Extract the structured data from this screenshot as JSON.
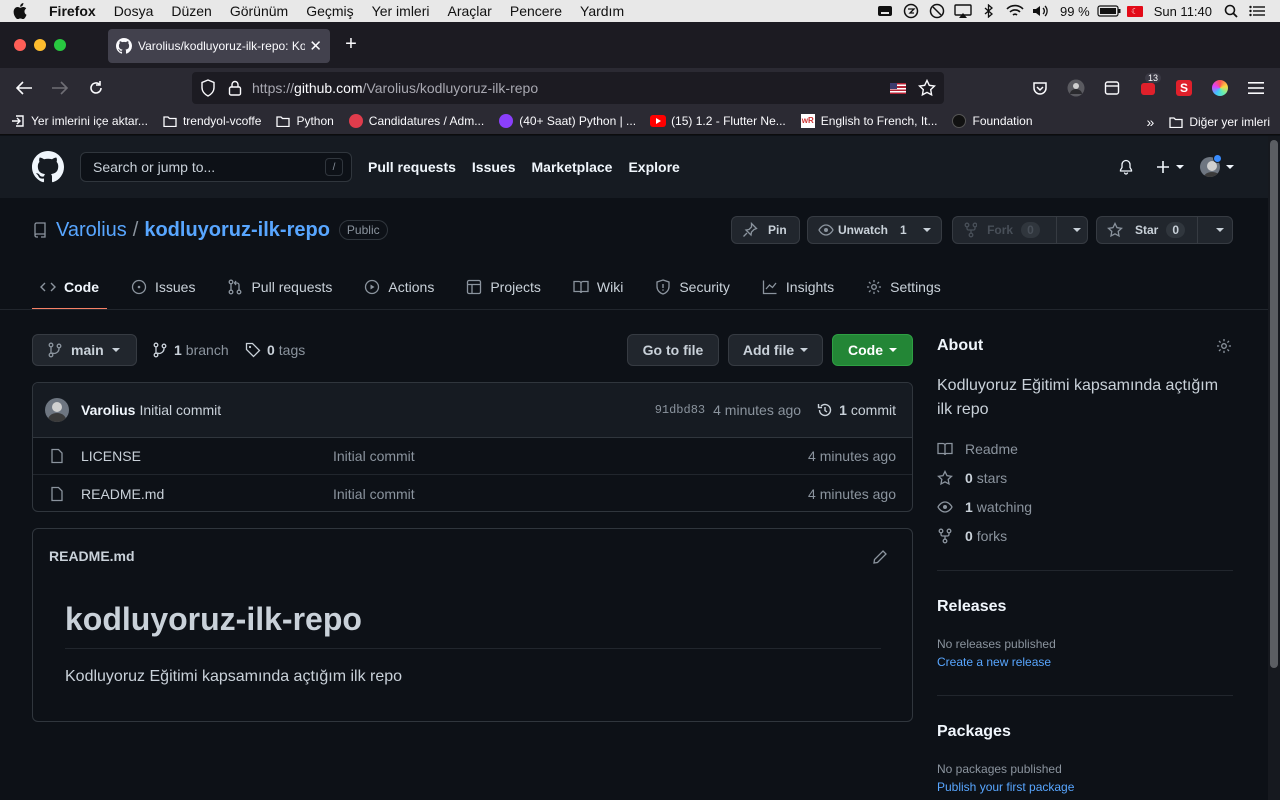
{
  "menubar": {
    "app": "Firefox",
    "items": [
      "Dosya",
      "Düzen",
      "Görünüm",
      "Geçmiş",
      "Yer imleri",
      "Araçlar",
      "Pencere",
      "Yardım"
    ],
    "battery": "99 %",
    "clock": "Sun 11:40"
  },
  "browser": {
    "tab_title": "Varolius/kodluyoruz-ilk-repo: Kodluyoruz Eğitimi kapsamında açtığım ilk repo",
    "url_prefix": "https://",
    "url_host": "github.com",
    "url_path": "/Varolius/kodluyoruz-ilk-repo",
    "ext_badge": "13"
  },
  "bookmarks": {
    "items": [
      {
        "label": "Yer imlerini içe aktar...",
        "icon": "import-icon"
      },
      {
        "label": "trendyol-vcoffe",
        "icon": "folder-icon"
      },
      {
        "label": "Python",
        "icon": "folder-icon"
      },
      {
        "label": "Candidatures / Adm...",
        "icon": "site-icon"
      },
      {
        "label": "(40+ Saat) Python | ...",
        "icon": "site-icon"
      },
      {
        "label": "(15) 1.2 - Flutter Ne...",
        "icon": "youtube-icon"
      },
      {
        "label": "English to French, It...",
        "icon": "site-icon"
      },
      {
        "label": "Foundation",
        "icon": "site-icon"
      }
    ],
    "other": "Diğer yer imleri"
  },
  "github": {
    "search_placeholder": "Search or jump to...",
    "search_key": "/",
    "nav": [
      "Pull requests",
      "Issues",
      "Marketplace",
      "Explore"
    ]
  },
  "repo": {
    "owner": "Varolius",
    "separator": "/",
    "name": "kodluyoruz-ilk-repo",
    "visibility": "Public",
    "pin_label": "Pin",
    "unwatch_label": "Unwatch",
    "unwatch_count": "1",
    "fork_label": "Fork",
    "fork_count": "0",
    "star_label": "Star",
    "star_count": "0"
  },
  "tabs": [
    "Code",
    "Issues",
    "Pull requests",
    "Actions",
    "Projects",
    "Wiki",
    "Security",
    "Insights",
    "Settings"
  ],
  "filenav": {
    "branch": "main",
    "branch_count": "1",
    "branch_word": "branch",
    "tag_count": "0",
    "tag_word": "tags",
    "goto_file": "Go to file",
    "add_file": "Add file",
    "code": "Code"
  },
  "commit": {
    "author": "Varolius",
    "message": "Initial commit",
    "sha": "91dbd83",
    "age": "4 minutes ago",
    "count": "1",
    "count_word": "commit"
  },
  "files": [
    {
      "name": "LICENSE",
      "message": "Initial commit",
      "age": "4 minutes ago"
    },
    {
      "name": "README.md",
      "message": "Initial commit",
      "age": "4 minutes ago"
    }
  ],
  "readme": {
    "filename": "README.md",
    "heading": "kodluyoruz-ilk-repo",
    "body": "Kodluyoruz Eğitimi kapsamında açtığım ilk repo"
  },
  "about": {
    "title": "About",
    "description": "Kodluyoruz Eğitimi kapsamında açtığım ilk repo",
    "readme": "Readme",
    "stars_n": "0",
    "stars_word": "stars",
    "watching_n": "1",
    "watching_word": "watching",
    "forks_n": "0",
    "forks_word": "forks"
  },
  "releases": {
    "title": "Releases",
    "none": "No releases published",
    "link": "Create a new release"
  },
  "packages": {
    "title": "Packages",
    "none": "No packages published",
    "link": "Publish your first package"
  },
  "colors": {
    "accent": "#58a6ff",
    "green_button": "#238636",
    "active_tab_underline": "#f78166",
    "page_bg": "#0d1117"
  }
}
